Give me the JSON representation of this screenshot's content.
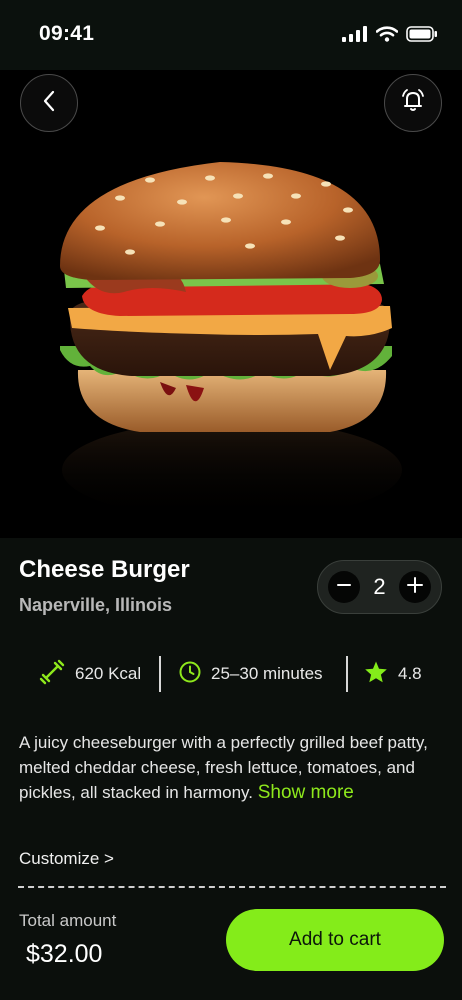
{
  "status_bar": {
    "time": "09:41",
    "icons": [
      "signal-icon",
      "wifi-icon",
      "battery-icon"
    ]
  },
  "hero": {
    "image": "cheeseburger-photo",
    "buttons": [
      "back-icon",
      "bell-icon"
    ]
  },
  "product": {
    "name": "Cheese Burger",
    "location": "Naperville, Illinois",
    "quantity": "2"
  },
  "stats": {
    "calories": "620 Kcal",
    "time": "25–30 minutes",
    "rating": "4.8"
  },
  "description": {
    "text": "A juicy cheeseburger with a perfectly grilled beef patty, melted cheddar cheese, fresh lettuce, tomatoes, and pickles, all stacked in harmony.",
    "show_more": "Show more"
  },
  "customize_label": "Customize >",
  "footer": {
    "total_label": "Total amount",
    "total_value": "$32.00",
    "cta_label": "Add to cart"
  },
  "colors": {
    "accent": "#84ec1a",
    "background": "#0b0f0c"
  }
}
